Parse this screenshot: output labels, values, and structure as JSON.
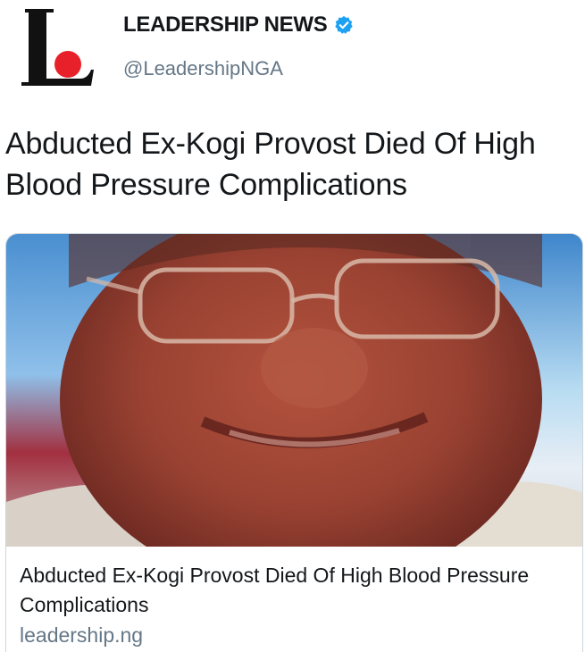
{
  "author": {
    "name": "LEADERSHIP NEWS",
    "handle": "@LeadershipNGA",
    "verified": true,
    "avatar_icon": "leadership-logo-icon"
  },
  "tweet": {
    "text": "Abducted Ex-Kogi Provost Died Of High Blood Pressure Complications"
  },
  "card": {
    "image_description_icon": "news-photo",
    "title": "Abducted Ex-Kogi Provost Died Of High Blood Pressure Complications",
    "domain": "leadership.ng"
  },
  "colors": {
    "text_primary": "#14171a",
    "text_secondary": "#657786",
    "verified_blue": "#1da1f2",
    "logo_red": "#e8202a",
    "card_border": "#ccd6dd"
  }
}
